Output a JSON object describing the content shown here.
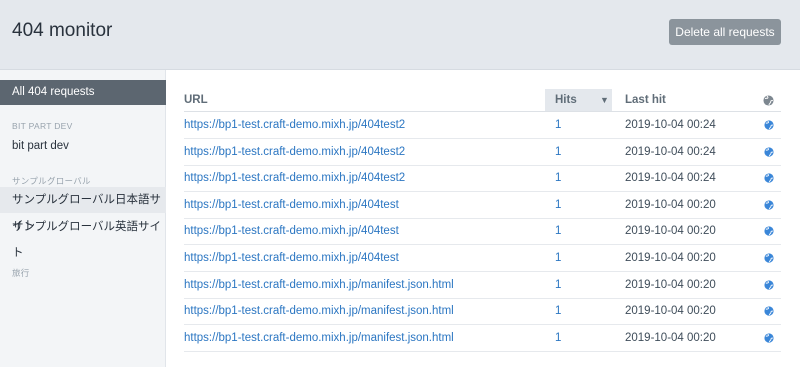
{
  "header": {
    "title": "404 monitor",
    "delete_label": "Delete all requests"
  },
  "sidebar": {
    "all_label": "All 404 requests",
    "groups": [
      {
        "heading": "BIT PART DEV",
        "items": [
          "bit part dev"
        ]
      },
      {
        "heading": "サンプルグローバル",
        "items": [
          "サンプルグローバル日本語サイト",
          "サンプルグローバル英語サイト"
        ]
      },
      {
        "heading": "旅行",
        "items": []
      }
    ]
  },
  "table": {
    "columns": {
      "url": "URL",
      "hits": "Hits",
      "last_hit": "Last hit",
      "sort_indicator": "▼"
    },
    "rows": [
      {
        "url": "https://bp1-test.craft-demo.mixh.jp/404test2",
        "hits": "1",
        "last_hit": "2019-10-04 00:24"
      },
      {
        "url": "https://bp1-test.craft-demo.mixh.jp/404test2",
        "hits": "1",
        "last_hit": "2019-10-04 00:24"
      },
      {
        "url": "https://bp1-test.craft-demo.mixh.jp/404test2",
        "hits": "1",
        "last_hit": "2019-10-04 00:24"
      },
      {
        "url": "https://bp1-test.craft-demo.mixh.jp/404test",
        "hits": "1",
        "last_hit": "2019-10-04 00:20"
      },
      {
        "url": "https://bp1-test.craft-demo.mixh.jp/404test",
        "hits": "1",
        "last_hit": "2019-10-04 00:20"
      },
      {
        "url": "https://bp1-test.craft-demo.mixh.jp/404test",
        "hits": "1",
        "last_hit": "2019-10-04 00:20"
      },
      {
        "url": "https://bp1-test.craft-demo.mixh.jp/manifest.json.html",
        "hits": "1",
        "last_hit": "2019-10-04 00:20"
      },
      {
        "url": "https://bp1-test.craft-demo.mixh.jp/manifest.json.html",
        "hits": "1",
        "last_hit": "2019-10-04 00:20"
      },
      {
        "url": "https://bp1-test.craft-demo.mixh.jp/manifest.json.html",
        "hits": "1",
        "last_hit": "2019-10-04 00:20"
      }
    ],
    "row_icon": "globe-icon"
  },
  "colors": {
    "header_bg": "#e4e8ed",
    "button_bg": "#8b949c",
    "sidebar_active_bg": "#5c6670",
    "link": "#2b76c2",
    "globe": "#3a86d8"
  }
}
